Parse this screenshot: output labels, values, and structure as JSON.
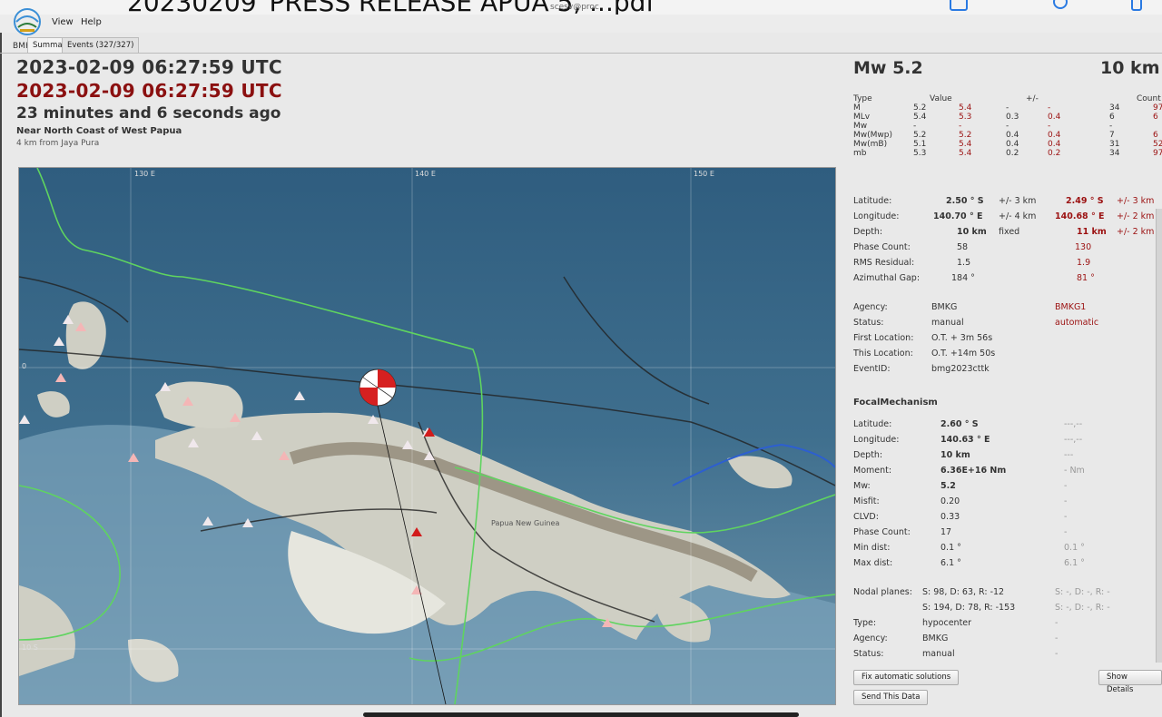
{
  "window": {
    "big_title": "20230209_PRESS RELEASE APUA 5, ...pdf",
    "title": "scesv@proc",
    "logo_text": "BMKG"
  },
  "menu": [
    "View",
    "Help"
  ],
  "tabs": [
    "Summary",
    "Events (327/327)"
  ],
  "summary": {
    "origin_time": "2023-02-09 06:27:59 UTC",
    "origin_time_auto": "2023-02-09 06:27:59 UTC",
    "elapsed": "23 minutes and 6 seconds ago",
    "region": "Near North Coast of West Papua",
    "nearest_city": "4 km from Jaya Pura"
  },
  "map": {
    "lon_labels": [
      "130 E",
      "140 E",
      "150 E"
    ],
    "lat_labels": [
      "0",
      "10 S"
    ],
    "place_label": "Papua New Guinea"
  },
  "magnitude": {
    "title": "Mw 5.2",
    "depth_title": "10 km",
    "headers": {
      "type": "Type",
      "value": "Value",
      "err": "+/-",
      "count": "Count"
    },
    "rows": [
      {
        "type": "M",
        "v1": "5.2",
        "v2": "5.4",
        "e1": "-",
        "e2": "-",
        "c1": "34",
        "c2": "97"
      },
      {
        "type": "MLv",
        "v1": "5.4",
        "v2": "5.3",
        "e1": "0.3",
        "e2": "0.4",
        "c1": "6",
        "c2": "6"
      },
      {
        "type": "Mw",
        "v1": "-",
        "v2": "-",
        "e1": "-",
        "e2": "-",
        "c1": "-",
        "c2": ""
      },
      {
        "type": "Mw(Mwp)",
        "v1": "5.2",
        "v2": "5.2",
        "e1": "0.4",
        "e2": "0.4",
        "c1": "7",
        "c2": "6"
      },
      {
        "type": "Mw(mB)",
        "v1": "5.1",
        "v2": "5.4",
        "e1": "0.4",
        "e2": "0.4",
        "c1": "31",
        "c2": "52"
      },
      {
        "type": "mb",
        "v1": "5.3",
        "v2": "5.4",
        "e1": "0.2",
        "e2": "0.2",
        "c1": "34",
        "c2": "97"
      }
    ]
  },
  "origin": {
    "latitude": {
      "label": "Latitude:",
      "v1": "2.50 ° S",
      "e1": "+/-  3 km",
      "v2": "2.49 ° S",
      "e2": "+/-  3 km"
    },
    "longitude": {
      "label": "Longitude:",
      "v1": "140.70 ° E",
      "e1": "+/-  4 km",
      "v2": "140.68 ° E",
      "e2": "+/-  2 km"
    },
    "depth": {
      "label": "Depth:",
      "v1": "10 km",
      "e1": "fixed",
      "v2": "11 km",
      "e2": "+/-  2 km"
    },
    "phase_count": {
      "label": "Phase Count:",
      "v1": "58",
      "v2": "130"
    },
    "rms": {
      "label": "RMS Residual:",
      "v1": "1.5",
      "v2": "1.9"
    },
    "gap": {
      "label": "Azimuthal Gap:",
      "v1": "184 °",
      "v2": "81 °"
    },
    "agency": {
      "label": "Agency:",
      "v1": "BMKG",
      "v2": "BMKG1"
    },
    "status": {
      "label": "Status:",
      "v1": "manual",
      "v2": "automatic"
    },
    "first_location": {
      "label": "First Location:",
      "v1": "O.T. + 3m 56s"
    },
    "this_location": {
      "label": "This Location:",
      "v1": "O.T. +14m 50s"
    },
    "event_id": {
      "label": "EventID:",
      "v1": "bmg2023cttk"
    }
  },
  "focal": {
    "title": "FocalMechanism",
    "rows": [
      {
        "label": "Latitude:",
        "v1": "2.60 ° S",
        "v2": "---,--",
        "bold": true
      },
      {
        "label": "Longitude:",
        "v1": "140.63 ° E",
        "v2": "---,--",
        "bold": true
      },
      {
        "label": "Depth:",
        "v1": "10 km",
        "v2": "---",
        "bold": true
      },
      {
        "label": "Moment:",
        "v1": "6.36E+16 Nm",
        "v2": "- Nm",
        "bold": true
      },
      {
        "label": "Mw:",
        "v1": "5.2",
        "v2": "-",
        "bold": true
      },
      {
        "label": "Misfit:",
        "v1": "0.20",
        "v2": "-"
      },
      {
        "label": "CLVD:",
        "v1": "0.33",
        "v2": "-"
      },
      {
        "label": "Phase Count:",
        "v1": "17",
        "v2": "-"
      },
      {
        "label": "Min dist:",
        "v1": "0.1 °",
        "v2": "0.1 °"
      },
      {
        "label": "Max dist:",
        "v1": "6.1 °",
        "v2": "6.1 °"
      }
    ],
    "nodal_label": "Nodal planes:",
    "nodal1": "S: 98, D: 63, R: -12",
    "nodal2": "S: 194, D: 78, R: -153",
    "nodal1_b": "S: -, D: -, R: -",
    "nodal2_b": "S: -, D: -, R: -",
    "type": {
      "label": "Type:",
      "v1": "hypocenter",
      "v2": "-"
    },
    "agency": {
      "label": "Agency:",
      "v1": "BMKG",
      "v2": "-"
    },
    "status": {
      "label": "Status:",
      "v1": "manual",
      "v2": "-"
    }
  },
  "buttons": {
    "fix_auto": "Fix automatic solutions",
    "send": "Send This Data",
    "show_details": "Show Details"
  }
}
